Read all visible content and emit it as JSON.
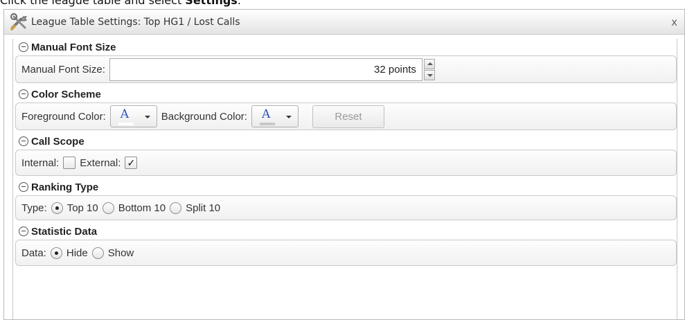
{
  "instruction": {
    "prefix": "Click the league table and select ",
    "bold": "Settings",
    "suffix": "."
  },
  "dialog": {
    "title": "League Table Settings: Top HG1 / Lost Calls",
    "close_label": "x"
  },
  "sections": {
    "font": {
      "heading": "Manual Font Size",
      "label": "Manual Font Size:",
      "value": "32 points"
    },
    "color": {
      "heading": "Color Scheme",
      "foreground_label": "Foreground Color:",
      "background_label": "Background Color:",
      "picker_glyph": "A",
      "foreground_swatch": "#ffffff",
      "background_swatch": "#c8c8c8",
      "reset_label": "Reset"
    },
    "scope": {
      "heading": "Call Scope",
      "internal_label": "Internal:",
      "internal_checked": false,
      "external_label": "External:",
      "external_checked": true,
      "check_glyph": "✓"
    },
    "ranking": {
      "heading": "Ranking Type",
      "label": "Type:",
      "options": [
        "Top 10",
        "Bottom 10",
        "Split 10"
      ],
      "selected": "Top 10"
    },
    "statistic": {
      "heading": "Statistic Data",
      "label": "Data:",
      "options": [
        "Hide",
        "Show"
      ],
      "selected": "Hide"
    }
  },
  "colors": {
    "accent_text": "#2f50b8",
    "panel_border": "#c9c9c9"
  }
}
